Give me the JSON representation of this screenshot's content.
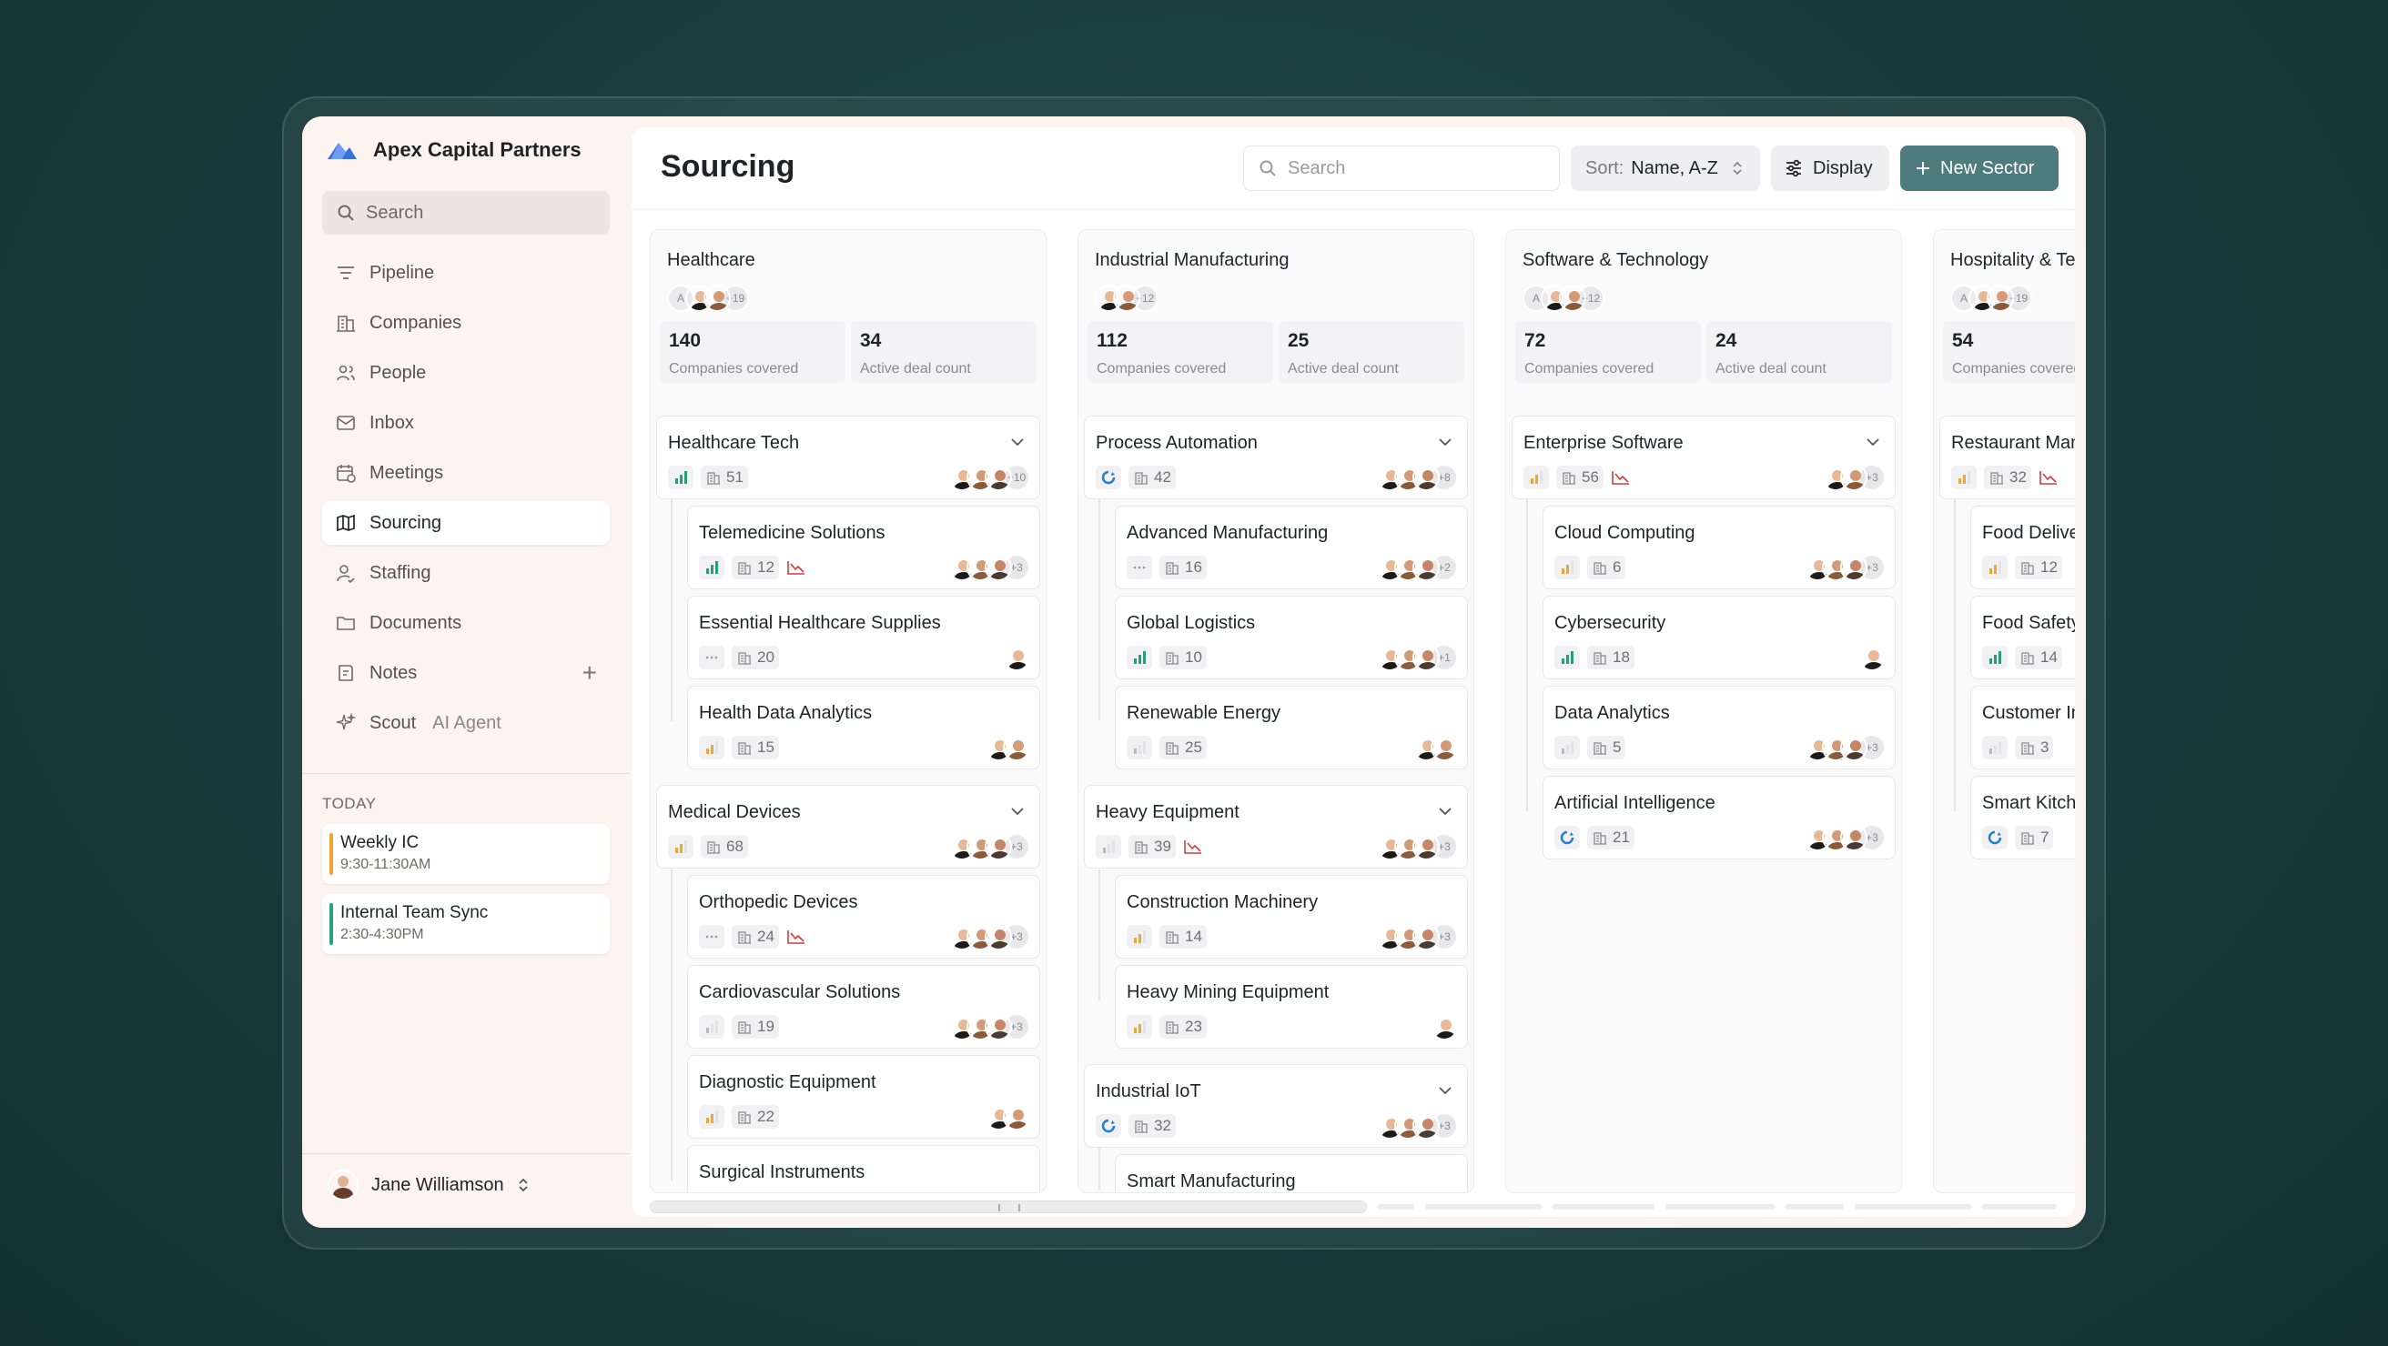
{
  "brand": {
    "name": "Apex Capital Partners"
  },
  "sidebar": {
    "search_label": "Search",
    "items": [
      {
        "label": "Pipeline",
        "icon": "filter-icon"
      },
      {
        "label": "Companies",
        "icon": "building-icon"
      },
      {
        "label": "People",
        "icon": "people-icon"
      },
      {
        "label": "Inbox",
        "icon": "inbox-icon"
      },
      {
        "label": "Meetings",
        "icon": "calendar-icon"
      },
      {
        "label": "Sourcing",
        "icon": "map-icon",
        "active": true
      },
      {
        "label": "Staffing",
        "icon": "person-icon"
      },
      {
        "label": "Documents",
        "icon": "folder-icon"
      },
      {
        "label": "Notes",
        "icon": "notes-icon"
      },
      {
        "label": "Scout",
        "sub": "AI Agent",
        "icon": "sparkle-icon"
      }
    ],
    "today_label": "TODAY",
    "events": [
      {
        "title": "Weekly IC",
        "time": "9:30-11:30AM",
        "color": "#f0a531"
      },
      {
        "title": "Internal Team Sync",
        "time": "2:30-4:30PM",
        "color": "#2aa37a"
      }
    ],
    "user": "Jane Williamson"
  },
  "toolbar": {
    "title": "Sourcing",
    "search_placeholder": "Search",
    "sort_label": "Sort:",
    "sort_value": "Name, A-Z",
    "display_label": "Display",
    "new_sector_label": "New Sector"
  },
  "columns": [
    {
      "name": "Healthcare",
      "team_more": "+19",
      "initials": "A",
      "stats": [
        {
          "n": "140",
          "l": "Companies covered"
        },
        {
          "n": "34",
          "l": "Active deal count"
        }
      ],
      "groups": [
        {
          "name": "Healthcare Tech",
          "signal": "green",
          "count": "51",
          "more": "+10",
          "subs": [
            {
              "name": "Telemedicine Solutions",
              "signal": "green",
              "count": "12",
              "trend": true,
              "more": "+3"
            },
            {
              "name": "Essential Healthcare Supplies",
              "signal": "none",
              "count": "20",
              "more": ""
            },
            {
              "name": "Health Data Analytics",
              "signal": "orange",
              "count": "15",
              "more": ""
            }
          ]
        },
        {
          "name": "Medical Devices",
          "signal": "orange",
          "count": "68",
          "more": "+3",
          "subs": [
            {
              "name": "Orthopedic Devices",
              "signal": "none",
              "count": "24",
              "trend": true,
              "more": "+3"
            },
            {
              "name": "Cardiovascular Solutions",
              "signal": "grey",
              "count": "19",
              "more": "+3"
            },
            {
              "name": "Diagnostic Equipment",
              "signal": "orange",
              "count": "22",
              "more": ""
            },
            {
              "name": "Surgical Instruments",
              "signal": "grey",
              "count": "",
              "more": ""
            }
          ]
        }
      ]
    },
    {
      "name": "Industrial Manufacturing",
      "team_more": "+12",
      "initials": "",
      "stats": [
        {
          "n": "112",
          "l": "Companies covered"
        },
        {
          "n": "25",
          "l": "Active deal count"
        }
      ],
      "groups": [
        {
          "name": "Process Automation",
          "signal": "loading",
          "count": "42",
          "more": "+8",
          "subs": [
            {
              "name": "Advanced Manufacturing",
              "signal": "none",
              "count": "16",
              "more": "+2"
            },
            {
              "name": "Global Logistics",
              "signal": "green",
              "count": "10",
              "more": "+1"
            },
            {
              "name": "Renewable Energy",
              "signal": "grey",
              "count": "25",
              "more": ""
            }
          ]
        },
        {
          "name": "Heavy Equipment",
          "signal": "grey",
          "count": "39",
          "trend": true,
          "more": "+3",
          "subs": [
            {
              "name": "Construction Machinery",
              "signal": "orange",
              "count": "14",
              "more": "+3"
            },
            {
              "name": "Heavy Mining Equipment",
              "signal": "orange",
              "count": "23",
              "more": ""
            }
          ]
        },
        {
          "name": "Industrial IoT",
          "signal": "loading",
          "count": "32",
          "more": "+3",
          "subs": [
            {
              "name": "Smart Manufacturing",
              "signal": "grey",
              "count": "",
              "more": ""
            }
          ]
        }
      ]
    },
    {
      "name": "Software & Technology",
      "team_more": "+12",
      "initials": "A",
      "stats": [
        {
          "n": "72",
          "l": "Companies covered"
        },
        {
          "n": "24",
          "l": "Active deal count"
        }
      ],
      "groups": [
        {
          "name": "Enterprise Software",
          "signal": "orange",
          "count": "56",
          "trend": true,
          "more": "+3",
          "subs": [
            {
              "name": "Cloud Computing",
              "signal": "orange",
              "count": "6",
              "more": "+3"
            },
            {
              "name": "Cybersecurity",
              "signal": "green",
              "count": "18",
              "more": ""
            },
            {
              "name": "Data Analytics",
              "signal": "grey",
              "count": "5",
              "more": "+3"
            },
            {
              "name": "Artificial Intelligence",
              "signal": "loading",
              "count": "21",
              "more": "+3"
            }
          ]
        }
      ]
    },
    {
      "name": "Hospitality & Technology",
      "team_more": "+19",
      "initials": "A",
      "stats": [
        {
          "n": "54",
          "l": "Companies covered"
        },
        {
          "n": "",
          "l": ""
        }
      ],
      "groups": [
        {
          "name": "Restaurant Management",
          "signal": "orange",
          "count": "32",
          "trend": true,
          "more": "",
          "subs": [
            {
              "name": "Food Delivery Solutions",
              "signal": "orange",
              "count": "12",
              "more": ""
            },
            {
              "name": "Food Safety Solutions",
              "signal": "green",
              "count": "14",
              "more": ""
            },
            {
              "name": "Customer Insights",
              "signal": "grey",
              "count": "3",
              "more": ""
            },
            {
              "name": "Smart Kitchen Technology",
              "signal": "loading",
              "count": "7",
              "more": ""
            }
          ]
        }
      ]
    }
  ]
}
